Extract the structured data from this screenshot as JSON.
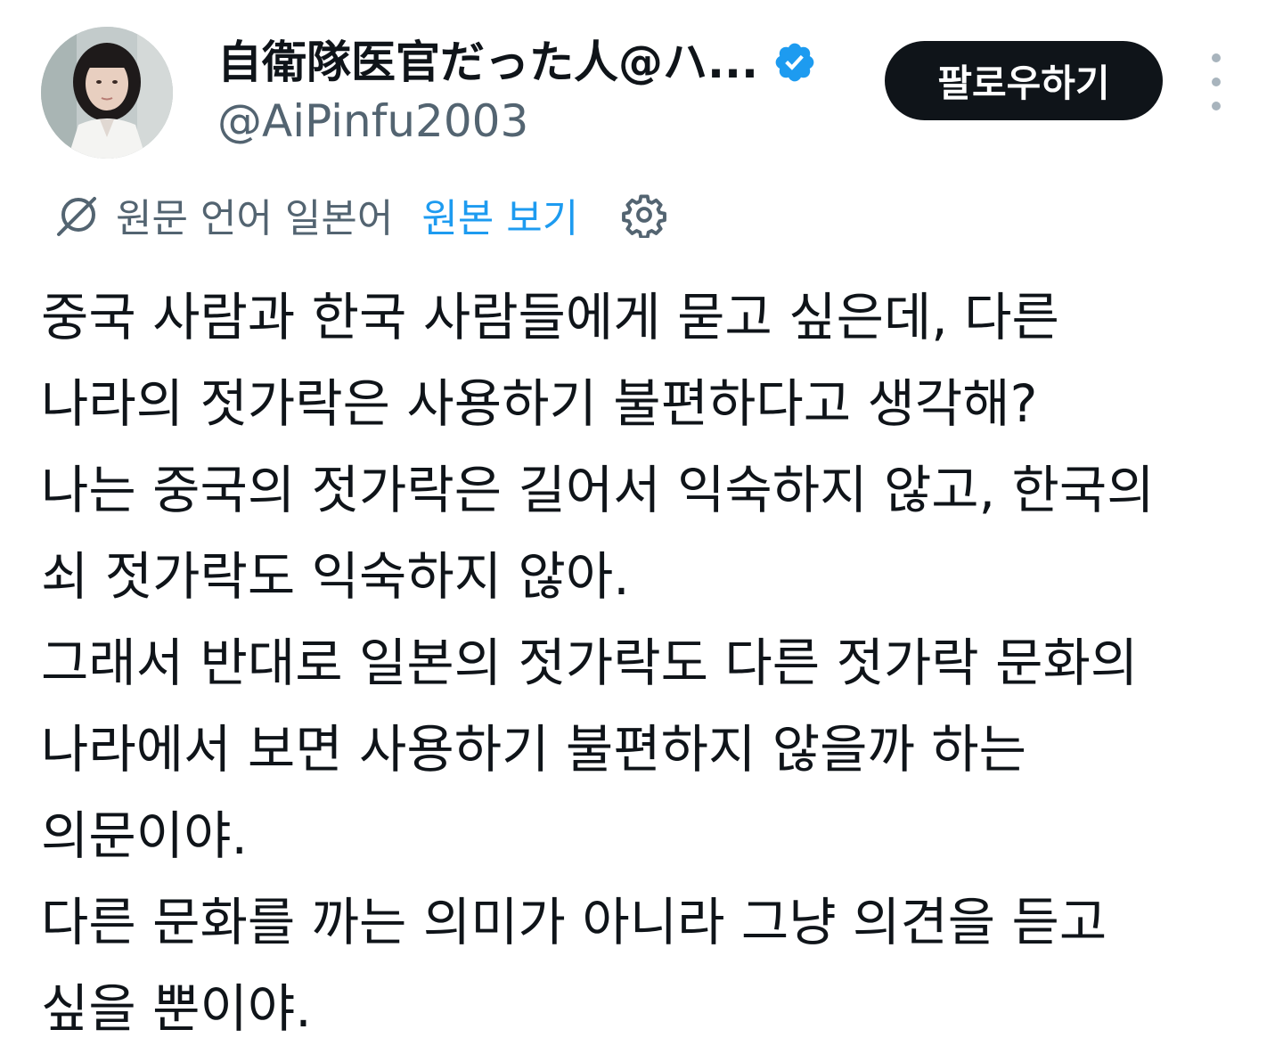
{
  "author": {
    "display_name": "自衛隊医官だった人@ハ...",
    "handle": "@AiPinfu2003",
    "verified": true,
    "avatar": "avatar-photo"
  },
  "actions": {
    "follow_label": "팔로우하기",
    "more_icon": "more-vertical-icon"
  },
  "translation": {
    "icon": "translate-icon",
    "label": "원문 언어 일본어",
    "view_original": "원본 보기",
    "settings_icon": "gear-icon"
  },
  "tweet": {
    "lines": [
      "중국 사람과 한국 사람들에게 묻고 싶은데, 다른",
      "나라의 젓가락은 사용하기 불편하다고 생각해?",
      "나는 중국의 젓가락은 길어서 익숙하지 않고, 한국의",
      "쇠 젓가락도 익숙하지 않아.",
      "그래서 반대로 일본의 젓가락도 다른 젓가락 문화의",
      "나라에서 보면 사용하기 불편하지 않을까 하는",
      "의문이야.",
      "다른 문화를 까는 의미가 아니라 그냥 의견을 듣고",
      "싶을 뿐이야."
    ]
  },
  "colors": {
    "text": "#0f1419",
    "secondary": "#536471",
    "link": "#1d9bf0",
    "verified_badge": "#1d9bf0",
    "follow_button_bg": "#0f1419"
  }
}
